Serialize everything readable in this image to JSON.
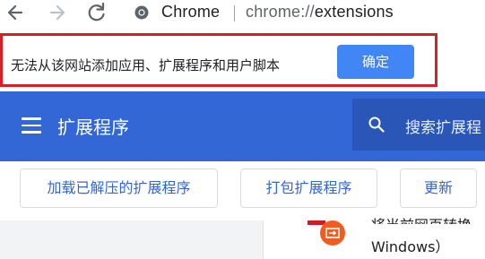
{
  "browser": {
    "site_label": "Chrome",
    "url_scheme": "chrome://",
    "url_host": "extensions"
  },
  "notice": {
    "message": "无法从该网站添加应用、扩展程序和用户脚本",
    "ok_label": "确定",
    "border_color": "#d61f26",
    "button_color": "#4285f4"
  },
  "header": {
    "title": "扩展程序",
    "search_placeholder": "搜索扩展程",
    "background_color": "#3367d6"
  },
  "actions": {
    "load_unpacked": "加载已解压的扩展程序",
    "pack": "打包扩展程序",
    "update": "更新"
  },
  "extension_card": {
    "line1": "将当前网页转换",
    "line2": "Windows）"
  },
  "icons": {
    "back": "arrow-left-icon",
    "forward": "arrow-right-icon",
    "reload": "reload-icon",
    "site": "chrome-icon",
    "menu": "hamburger-menu-icon",
    "search": "search-icon",
    "extension": "extension-logo-icon"
  }
}
